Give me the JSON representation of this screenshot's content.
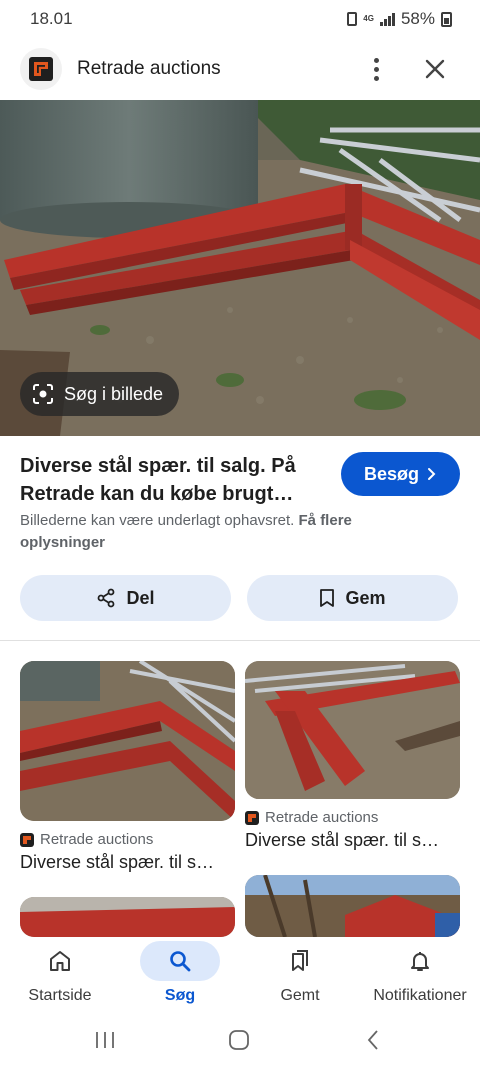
{
  "status_bar": {
    "time": "18.01",
    "network": "4G",
    "battery": "58%"
  },
  "header": {
    "site_title": "Retrade auctions"
  },
  "hero": {
    "lens_label": "Søg i billede"
  },
  "result": {
    "title_line1": "Diverse stål spær. til salg. På",
    "title_line2": "Retrade kan du købe brugt…",
    "visit_label": "Besøg",
    "copyright_text": "Billederne kan være underlagt ophavsret.",
    "more_info_label": "Få flere oplysninger",
    "share_label": "Del",
    "save_label": "Gem"
  },
  "related": [
    {
      "source": "Retrade auctions",
      "title": "Diverse stål spær. til s…"
    },
    {
      "source": "Retrade auctions",
      "title": "Diverse stål spær. til s…"
    }
  ],
  "bottom_nav": [
    {
      "label": "Startside",
      "icon": "home-icon",
      "active": false
    },
    {
      "label": "Søg",
      "icon": "search-icon",
      "active": true
    },
    {
      "label": "Gemt",
      "icon": "bookmarks-icon",
      "active": false
    },
    {
      "label": "Notifikationer",
      "icon": "bell-icon",
      "active": false
    }
  ],
  "colors": {
    "accent": "#0b57d0",
    "chip_bg": "#e3ebf8",
    "beam_red": "#b8332a"
  }
}
